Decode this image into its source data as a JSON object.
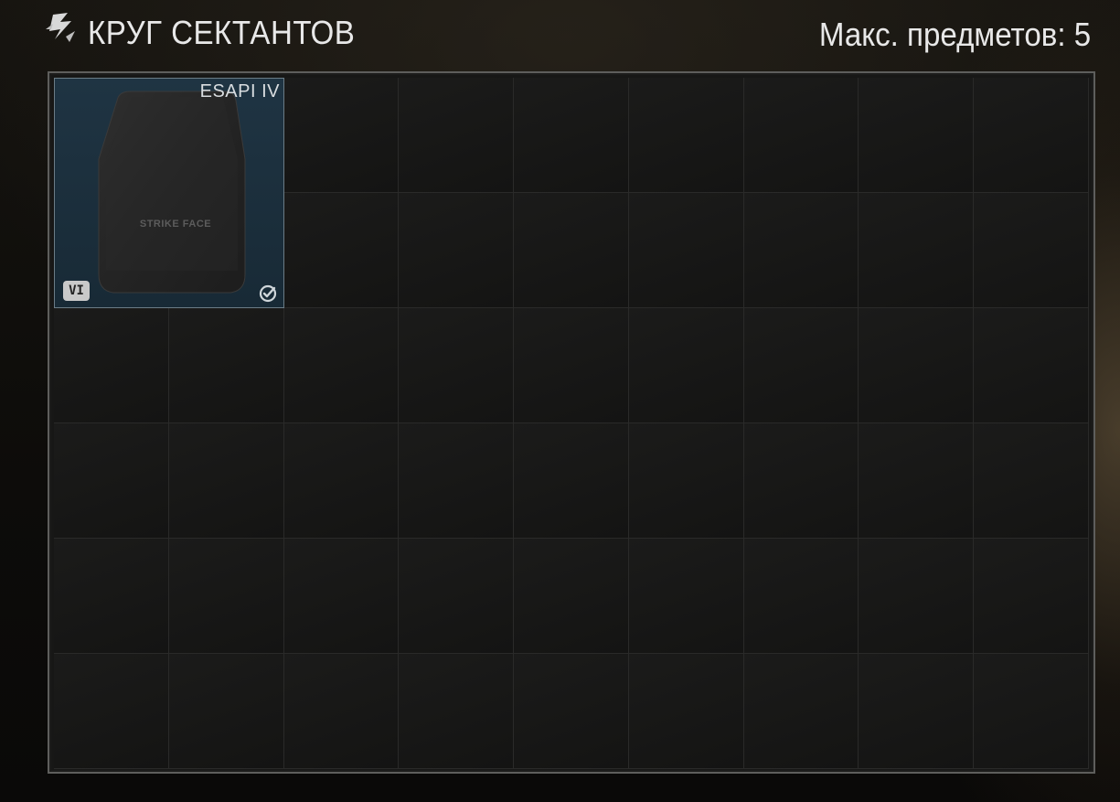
{
  "header": {
    "title": "КРУГ СЕКТАНТОВ",
    "max_items_label": "Макс. предметов: 5",
    "logo_icon": "cultist-circle-logo-icon"
  },
  "grid": {
    "columns": 9,
    "rows": 6
  },
  "items": [
    {
      "name": "ESAPI IV",
      "plate_text": "STRIKE FACE",
      "class_badge": "VI",
      "status_icon": "checkmark-circle-icon",
      "background_color": "#1c3040"
    }
  ],
  "colors": {
    "text": "#e8e8e8",
    "item_background": "#1c3040",
    "grid_border": "#5e5e5c"
  }
}
